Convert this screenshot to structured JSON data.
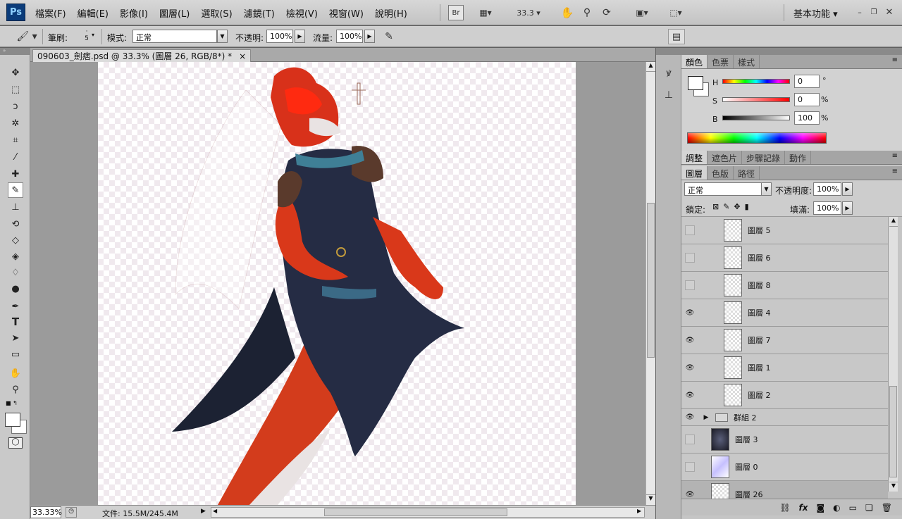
{
  "menubar": {
    "logo": "Ps",
    "items": [
      "檔案(F)",
      "編輯(E)",
      "影像(I)",
      "圖層(L)",
      "選取(S)",
      "濾鏡(T)",
      "檢視(V)",
      "視窗(W)",
      "說明(H)"
    ],
    "bridge_label": "Br",
    "zoom_value": "33.3",
    "workspace_label": "基本功能"
  },
  "options": {
    "brush_label": "筆刷:",
    "brush_size": "5",
    "mode_label": "模式:",
    "mode_value": "正常",
    "opacity_label": "不透明:",
    "opacity_value": "100%",
    "flow_label": "流量:",
    "flow_value": "100%"
  },
  "document": {
    "tab_title": "090603_劍痞.psd @ 33.3% (圖層 26, RGB/8*) *",
    "close_glyph": "×"
  },
  "status": {
    "zoom": "33.33%",
    "file_info": "文件: 15.5M/245.4M"
  },
  "color_panel": {
    "tabs": [
      "顏色",
      "色票",
      "樣式"
    ],
    "h_label": "H",
    "h_value": "0",
    "h_unit": "°",
    "s_label": "S",
    "s_value": "0",
    "s_unit": "%",
    "b_label": "B",
    "b_value": "100",
    "b_unit": "%"
  },
  "adjust_panel": {
    "tabs": [
      "調整",
      "遮色片",
      "步驟記錄",
      "動作"
    ]
  },
  "layers_panel": {
    "tabs": [
      "圖層",
      "色版",
      "路徑"
    ],
    "blend_mode": "正常",
    "opacity_label": "不透明度:",
    "opacity_value": "100%",
    "lock_label": "鎖定:",
    "fill_label": "填滿:",
    "fill_value": "100%",
    "layers": [
      {
        "name": "圖層 5",
        "visible": false
      },
      {
        "name": "圖層 6",
        "visible": false
      },
      {
        "name": "圖層 8",
        "visible": false
      },
      {
        "name": "圖層 4",
        "visible": true
      },
      {
        "name": "圖層 7",
        "visible": true
      },
      {
        "name": "圖層 1",
        "visible": true
      },
      {
        "name": "圖層 2",
        "visible": true
      },
      {
        "name": "群組 2",
        "visible": true
      },
      {
        "name": "圖層 3",
        "visible": false
      },
      {
        "name": "圖層 0",
        "visible": false
      },
      {
        "name": "圖層 26",
        "visible": true
      }
    ]
  }
}
